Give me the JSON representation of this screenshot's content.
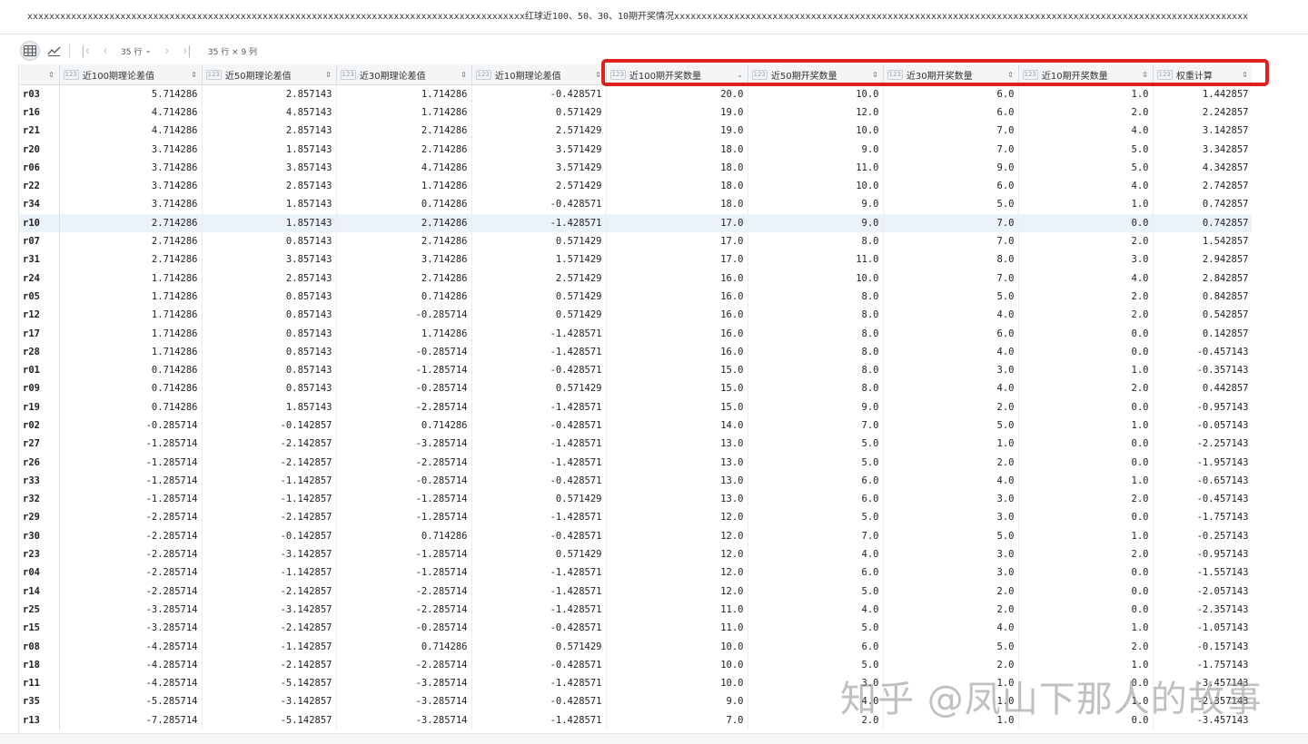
{
  "title": "xxxxxxxxxxxxxxxxxxxxxxxxxxxxxxxxxxxxxxxxxxxxxxxxxxxxxxxxxxxxxxxxxxxxxxxxxxxxxxxxxxxxxxxxxxx红球近100、50、30、10期开奖情况xxxxxxxxxxxxxxxxxxxxxxxxxxxxxxxxxxxxxxxxxxxxxxxxxxxxxxxxxxxxxxxxxxxxxxxxxxxxxxxxxxxxxxxxxxxxxxxxxxxxxxxxx",
  "toolbar": {
    "rows_label": "35 行",
    "info": "35 行 × 9 列",
    "icons": [
      "grid-view-icon",
      "chart-view-icon",
      "first-page-icon",
      "prev-page-icon",
      "next-page-icon",
      "last-page-icon"
    ]
  },
  "type_badge": "123",
  "columns": [
    "近100期理论差值",
    "近50期理论差值",
    "近30期理论差值",
    "近10期理论差值",
    "近100期开奖数量",
    "近50期开奖数量",
    "近30期开奖数量",
    "近10期开奖数量",
    "权重计算"
  ],
  "rows": [
    [
      "r03",
      "5.714286",
      "2.857143",
      "1.714286",
      "-0.428571",
      "20.0",
      "10.0",
      "6.0",
      "1.0",
      "1.442857"
    ],
    [
      "r16",
      "4.714286",
      "4.857143",
      "1.714286",
      "0.571429",
      "19.0",
      "12.0",
      "6.0",
      "2.0",
      "2.242857"
    ],
    [
      "r21",
      "4.714286",
      "2.857143",
      "2.714286",
      "2.571429",
      "19.0",
      "10.0",
      "7.0",
      "4.0",
      "3.142857"
    ],
    [
      "r20",
      "3.714286",
      "1.857143",
      "2.714286",
      "3.571429",
      "18.0",
      "9.0",
      "7.0",
      "5.0",
      "3.342857"
    ],
    [
      "r06",
      "3.714286",
      "3.857143",
      "4.714286",
      "3.571429",
      "18.0",
      "11.0",
      "9.0",
      "5.0",
      "4.342857"
    ],
    [
      "r22",
      "3.714286",
      "2.857143",
      "1.714286",
      "2.571429",
      "18.0",
      "10.0",
      "6.0",
      "4.0",
      "2.742857"
    ],
    [
      "r34",
      "3.714286",
      "1.857143",
      "0.714286",
      "-0.428571",
      "18.0",
      "9.0",
      "5.0",
      "1.0",
      "0.742857"
    ],
    [
      "r10",
      "2.714286",
      "1.857143",
      "2.714286",
      "-1.428571",
      "17.0",
      "9.0",
      "7.0",
      "0.0",
      "0.742857"
    ],
    [
      "r07",
      "2.714286",
      "0.857143",
      "2.714286",
      "0.571429",
      "17.0",
      "8.0",
      "7.0",
      "2.0",
      "1.542857"
    ],
    [
      "r31",
      "2.714286",
      "3.857143",
      "3.714286",
      "1.571429",
      "17.0",
      "11.0",
      "8.0",
      "3.0",
      "2.942857"
    ],
    [
      "r24",
      "1.714286",
      "2.857143",
      "2.714286",
      "2.571429",
      "16.0",
      "10.0",
      "7.0",
      "4.0",
      "2.842857"
    ],
    [
      "r05",
      "1.714286",
      "0.857143",
      "0.714286",
      "0.571429",
      "16.0",
      "8.0",
      "5.0",
      "2.0",
      "0.842857"
    ],
    [
      "r12",
      "1.714286",
      "0.857143",
      "-0.285714",
      "0.571429",
      "16.0",
      "8.0",
      "4.0",
      "2.0",
      "0.542857"
    ],
    [
      "r17",
      "1.714286",
      "0.857143",
      "1.714286",
      "-1.428571",
      "16.0",
      "8.0",
      "6.0",
      "0.0",
      "0.142857"
    ],
    [
      "r28",
      "1.714286",
      "0.857143",
      "-0.285714",
      "-1.428571",
      "16.0",
      "8.0",
      "4.0",
      "0.0",
      "-0.457143"
    ],
    [
      "r01",
      "0.714286",
      "0.857143",
      "-1.285714",
      "-0.428571",
      "15.0",
      "8.0",
      "3.0",
      "1.0",
      "-0.357143"
    ],
    [
      "r09",
      "0.714286",
      "0.857143",
      "-0.285714",
      "0.571429",
      "15.0",
      "8.0",
      "4.0",
      "2.0",
      "0.442857"
    ],
    [
      "r19",
      "0.714286",
      "1.857143",
      "-2.285714",
      "-1.428571",
      "15.0",
      "9.0",
      "2.0",
      "0.0",
      "-0.957143"
    ],
    [
      "r02",
      "-0.285714",
      "-0.142857",
      "0.714286",
      "-0.428571",
      "14.0",
      "7.0",
      "5.0",
      "1.0",
      "-0.057143"
    ],
    [
      "r27",
      "-1.285714",
      "-2.142857",
      "-3.285714",
      "-1.428571",
      "13.0",
      "5.0",
      "1.0",
      "0.0",
      "-2.257143"
    ],
    [
      "r26",
      "-1.285714",
      "-2.142857",
      "-2.285714",
      "-1.428571",
      "13.0",
      "5.0",
      "2.0",
      "0.0",
      "-1.957143"
    ],
    [
      "r33",
      "-1.285714",
      "-1.142857",
      "-0.285714",
      "-0.428571",
      "13.0",
      "6.0",
      "4.0",
      "1.0",
      "-0.657143"
    ],
    [
      "r32",
      "-1.285714",
      "-1.142857",
      "-1.285714",
      "0.571429",
      "13.0",
      "6.0",
      "3.0",
      "2.0",
      "-0.457143"
    ],
    [
      "r29",
      "-2.285714",
      "-2.142857",
      "-1.285714",
      "-1.428571",
      "12.0",
      "5.0",
      "3.0",
      "0.0",
      "-1.757143"
    ],
    [
      "r30",
      "-2.285714",
      "-0.142857",
      "0.714286",
      "-0.428571",
      "12.0",
      "7.0",
      "5.0",
      "1.0",
      "-0.257143"
    ],
    [
      "r23",
      "-2.285714",
      "-3.142857",
      "-1.285714",
      "0.571429",
      "12.0",
      "4.0",
      "3.0",
      "2.0",
      "-0.957143"
    ],
    [
      "r04",
      "-2.285714",
      "-1.142857",
      "-1.285714",
      "-1.428571",
      "12.0",
      "6.0",
      "3.0",
      "0.0",
      "-1.557143"
    ],
    [
      "r14",
      "-2.285714",
      "-2.142857",
      "-2.285714",
      "-1.428571",
      "12.0",
      "5.0",
      "2.0",
      "0.0",
      "-2.057143"
    ],
    [
      "r25",
      "-3.285714",
      "-3.142857",
      "-2.285714",
      "-1.428571",
      "11.0",
      "4.0",
      "2.0",
      "0.0",
      "-2.357143"
    ],
    [
      "r15",
      "-3.285714",
      "-2.142857",
      "-0.285714",
      "-0.428571",
      "11.0",
      "5.0",
      "4.0",
      "1.0",
      "-1.057143"
    ],
    [
      "r08",
      "-4.285714",
      "-1.142857",
      "0.714286",
      "0.571429",
      "10.0",
      "6.0",
      "5.0",
      "2.0",
      "-0.157143"
    ],
    [
      "r18",
      "-4.285714",
      "-2.142857",
      "-2.285714",
      "-0.428571",
      "10.0",
      "5.0",
      "2.0",
      "1.0",
      "-1.757143"
    ],
    [
      "r11",
      "-4.285714",
      "-5.142857",
      "-3.285714",
      "-1.428571",
      "10.0",
      "3.0",
      "1.0",
      "0.0",
      "-3.457143"
    ],
    [
      "r35",
      "-5.285714",
      "-3.142857",
      "-3.285714",
      "-0.428571",
      "9.0",
      "4.0",
      "1.0",
      "1.0",
      "-2.357143"
    ],
    [
      "r13",
      "-7.285714",
      "-5.142857",
      "-3.285714",
      "-1.428571",
      "7.0",
      "2.0",
      "1.0",
      "0.0",
      "-3.457143"
    ]
  ],
  "selected_row": "r10",
  "sorted_column": "近100期开奖数量",
  "highlight_color": "#e0201c",
  "selection_color": "#ebf2fb",
  "watermark": "知乎 @凤山下那人的故事"
}
